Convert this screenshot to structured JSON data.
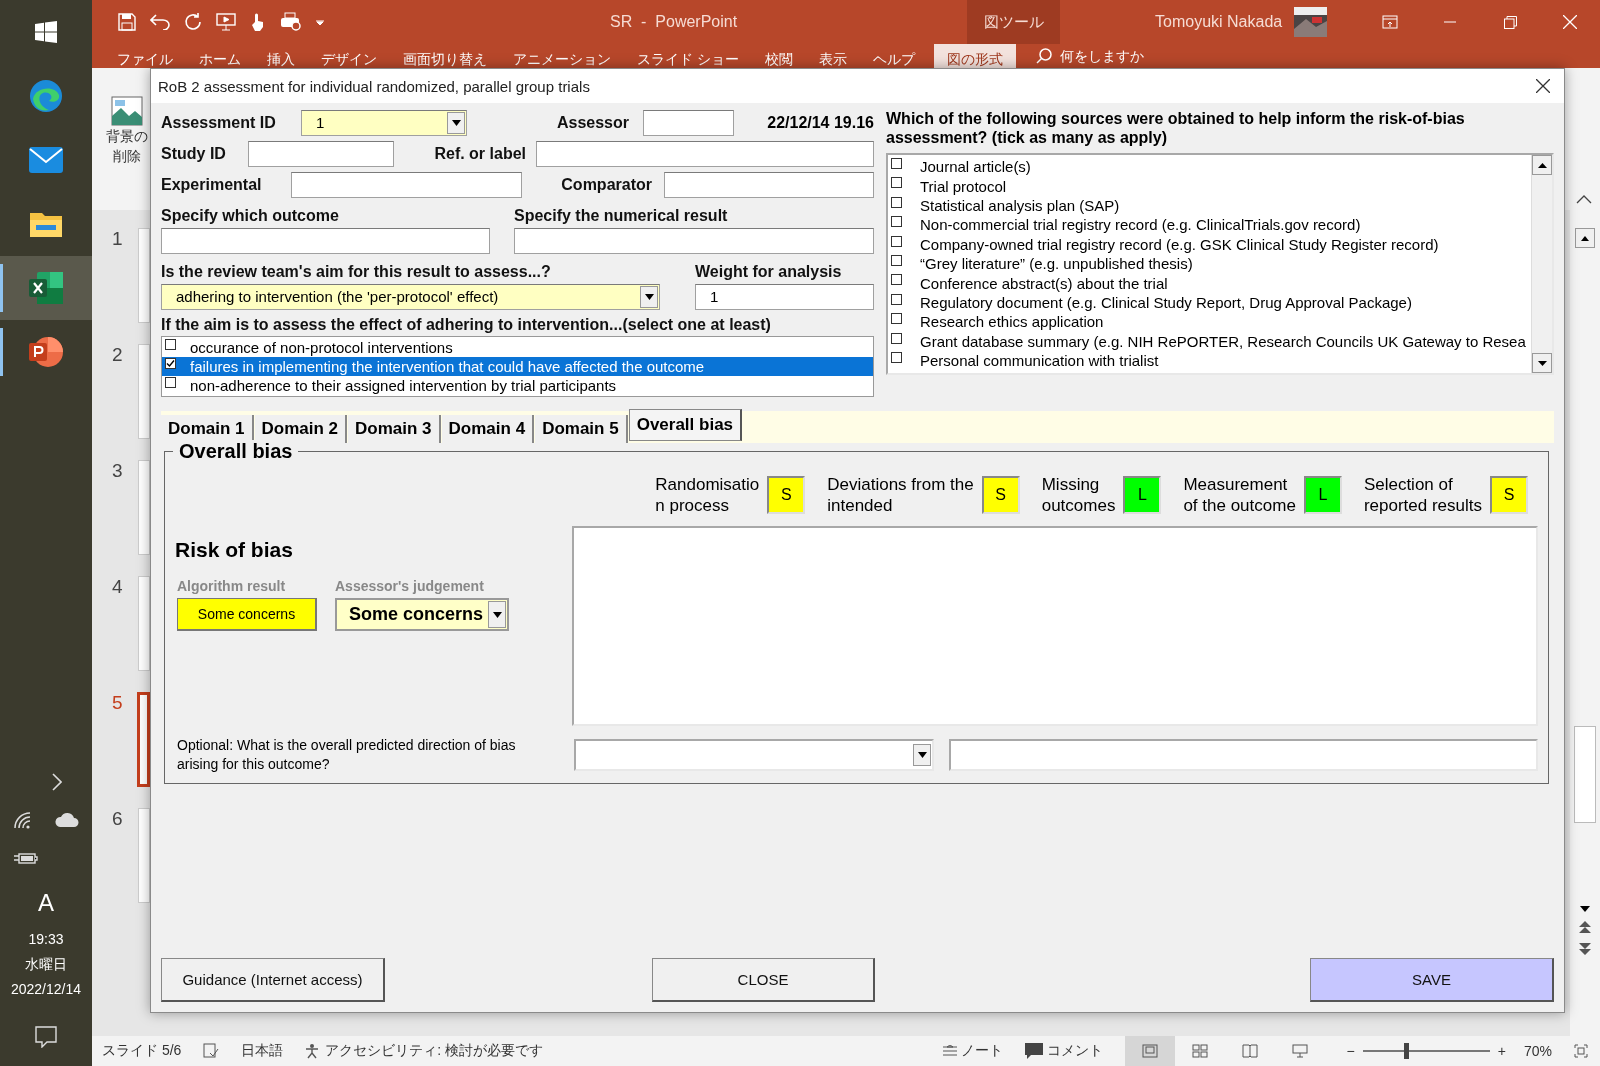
{
  "taskbar": {
    "clock": {
      "time": "19:33",
      "day": "水曜日",
      "date": "2022/12/14"
    },
    "input_indicator": "A"
  },
  "powerpoint": {
    "title": "SR  -  PowerPoint",
    "context_tab": "図ツール",
    "user": "Tomoyuki Nakada",
    "ribbon_tabs": [
      {
        "label": "ファイル",
        "selected": false
      },
      {
        "label": "ホーム",
        "selected": false
      },
      {
        "label": "挿入",
        "selected": false
      },
      {
        "label": "デザイン",
        "selected": false
      },
      {
        "label": "画面切り替え",
        "selected": false
      },
      {
        "label": "アニメーション",
        "selected": false
      },
      {
        "label": "スライド ショー",
        "selected": false
      },
      {
        "label": "校閲",
        "selected": false
      },
      {
        "label": "表示",
        "selected": false
      },
      {
        "label": "ヘルプ",
        "selected": false
      },
      {
        "label": "図の形式",
        "selected": true
      }
    ],
    "search_hint": "何をしますか",
    "ribbon_button": {
      "lines": [
        "背景の",
        "削除"
      ]
    },
    "slides": [
      {
        "number": "1",
        "selected": false
      },
      {
        "number": "2",
        "selected": false
      },
      {
        "number": "3",
        "selected": false
      },
      {
        "number": "4",
        "selected": false
      },
      {
        "number": "5",
        "selected": true
      },
      {
        "number": "6",
        "selected": false
      }
    ],
    "status_bar": {
      "slide": "スライド 5/6",
      "language": "日本語",
      "accessibility": "アクセシビリティ: 検討が必要です",
      "notes": "ノート",
      "comments": "コメント",
      "zoom": {
        "minus": "−",
        "plus": "+",
        "level": 0.34,
        "reading": "70%"
      }
    }
  },
  "dialog": {
    "title": "RoB 2 assessment for individual randomized, parallel group trials",
    "assessment_id": {
      "label": "Assessment ID",
      "value": "1"
    },
    "assessor": {
      "label": "Assessor"
    },
    "timestamp": "22/12/14 19.16",
    "study_id": {
      "label": "Study ID"
    },
    "ref_label": {
      "label": "Ref. or label"
    },
    "experimental": {
      "label": "Experimental"
    },
    "comparator": {
      "label": "Comparator"
    },
    "outcome": {
      "label": "Specify which outcome"
    },
    "numerical_result": {
      "label": "Specify the numerical result"
    },
    "aim": {
      "label": "Is the review team's aim for this result to assess...?",
      "value": "adhering to intervention (the 'per-protocol' effect)"
    },
    "weight": {
      "label": "Weight for analysis",
      "value": "1"
    },
    "adherence": {
      "label": "If the aim is to assess the effect of adhering to intervention...(select one at least)",
      "options": [
        {
          "label": "occurance of non-protocol interventions",
          "checked": false,
          "selected": false
        },
        {
          "label": "failures in implementing the intervention that could have affected the outcome",
          "checked": true,
          "selected": true
        },
        {
          "label": "non-adherence to their assigned intervention by trial participants",
          "checked": false,
          "selected": false
        }
      ]
    },
    "sources": {
      "label": "Which of the following sources were obtained to help inform the risk-of-bias assessment? (tick as many as apply)",
      "items": [
        {
          "label": "Journal article(s)",
          "checked": false
        },
        {
          "label": "Trial protocol",
          "checked": false
        },
        {
          "label": "Statistical analysis plan (SAP)",
          "checked": false
        },
        {
          "label": "Non-commercial trial registry record (e.g. ClinicalTrials.gov record)",
          "checked": false
        },
        {
          "label": "Company-owned trial registry record (e.g. GSK Clinical Study Register record)",
          "checked": false
        },
        {
          "label": "“Grey literature” (e.g. unpublished thesis)",
          "checked": false
        },
        {
          "label": "Conference abstract(s) about the trial",
          "checked": false
        },
        {
          "label": "Regulatory document (e.g. Clinical Study Report, Drug Approval Package)",
          "checked": false
        },
        {
          "label": "Research ethics application",
          "checked": false
        },
        {
          "label": "Grant database summary (e.g. NIH RePORTER, Research Councils UK Gateway to Resea",
          "checked": false
        },
        {
          "label": "Personal communication with trialist",
          "checked": false
        }
      ]
    },
    "tabs": [
      {
        "label": "Domain 1",
        "selected": false
      },
      {
        "label": "Domain 2",
        "selected": false
      },
      {
        "label": "Domain 3",
        "selected": false
      },
      {
        "label": "Domain 4",
        "selected": false
      },
      {
        "label": "Domain 5",
        "selected": false
      },
      {
        "label": "Overall bias",
        "selected": true
      }
    ],
    "overall": {
      "title": "Overall bias",
      "domains": [
        {
          "label": "Randomisatio\nn process",
          "judgement": "S",
          "color": "#ffff00"
        },
        {
          "label": "Deviations from the\nintended",
          "judgement": "S",
          "color": "#ffff00"
        },
        {
          "label": "Missing\noutcomes",
          "judgement": "L",
          "color": "#00ff00"
        },
        {
          "label": "Measurement\nof the outcome",
          "judgement": "L",
          "color": "#00ff00"
        },
        {
          "label": "Selection of\nreported results",
          "judgement": "S",
          "color": "#ffff00"
        }
      ],
      "heading": "Risk of bias",
      "algorithm": {
        "label": "Algorithm result",
        "value": "Some concerns"
      },
      "judgement": {
        "label": "Assessor's judgement",
        "value": "Some concerns"
      },
      "direction": {
        "label": "Optional: What is the overall predicted direction of bias\narising for this outcome?"
      }
    },
    "buttons": [
      {
        "label": "Guidance (Internet access)",
        "kind": "default"
      },
      {
        "label": "CLOSE",
        "kind": "default"
      },
      {
        "label": "SAVE",
        "kind": "primary"
      }
    ]
  }
}
